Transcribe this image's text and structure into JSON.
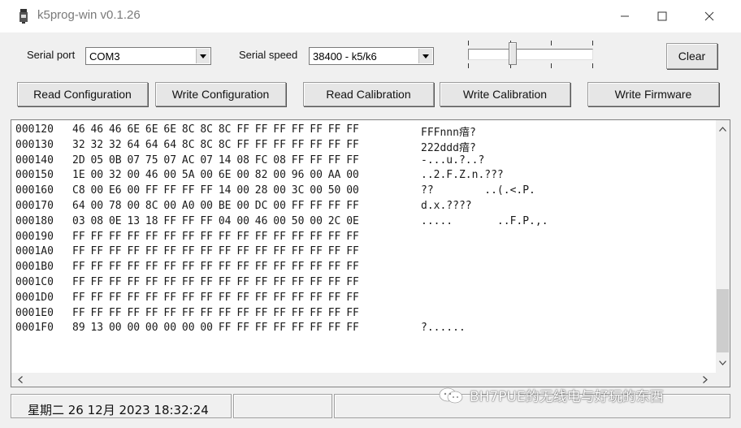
{
  "window": {
    "title": "k5prog-win v0.1.26"
  },
  "controls": {
    "serial_port_label": "Serial port",
    "serial_port_value": "COM3",
    "serial_speed_label": "Serial speed",
    "serial_speed_value": "38400 - k5/k6",
    "clear_button": "Clear",
    "slider_level": 0.35
  },
  "actions": {
    "read_config": "Read Configuration",
    "write_config": "Write Configuration",
    "read_calib": "Read Calibration",
    "write_calib": "Write Calibration",
    "write_firmware": "Write Firmware"
  },
  "hex_rows": [
    {
      "addr": "000120",
      "bytes": "46 46 46 6E 6E 6E 8C 8C 8C FF FF FF FF FF FF FF",
      "ascii": "FFFnnn瘖?"
    },
    {
      "addr": "000130",
      "bytes": "32 32 32 64 64 64 8C 8C 8C FF FF FF FF FF FF FF",
      "ascii": "222ddd瘖?"
    },
    {
      "addr": "000140",
      "bytes": "2D 05 0B 07 75 07 AC 07 14 08 FC 08 FF FF FF FF",
      "ascii": "-...u.?..?"
    },
    {
      "addr": "000150",
      "bytes": "1E 00 32 00 46 00 5A 00 6E 00 82 00 96 00 AA 00",
      "ascii": "..2.F.Z.n.???"
    },
    {
      "addr": "000160",
      "bytes": "C8 00 E6 00 FF FF FF FF 14 00 28 00 3C 00 50 00",
      "ascii": "??        ..(.<.P."
    },
    {
      "addr": "000170",
      "bytes": "64 00 78 00 8C 00 A0 00 BE 00 DC 00 FF FF FF FF",
      "ascii": "d.x.????"
    },
    {
      "addr": "000180",
      "bytes": "03 08 0E 13 18 FF FF FF 04 00 46 00 50 00 2C 0E",
      "ascii": ".....       ..F.P.,."
    },
    {
      "addr": "000190",
      "bytes": "FF FF FF FF FF FF FF FF FF FF FF FF FF FF FF FF",
      "ascii": ""
    },
    {
      "addr": "0001A0",
      "bytes": "FF FF FF FF FF FF FF FF FF FF FF FF FF FF FF FF",
      "ascii": ""
    },
    {
      "addr": "0001B0",
      "bytes": "FF FF FF FF FF FF FF FF FF FF FF FF FF FF FF FF",
      "ascii": ""
    },
    {
      "addr": "0001C0",
      "bytes": "FF FF FF FF FF FF FF FF FF FF FF FF FF FF FF FF",
      "ascii": ""
    },
    {
      "addr": "0001D0",
      "bytes": "FF FF FF FF FF FF FF FF FF FF FF FF FF FF FF FF",
      "ascii": ""
    },
    {
      "addr": "0001E0",
      "bytes": "FF FF FF FF FF FF FF FF FF FF FF FF FF FF FF FF",
      "ascii": ""
    },
    {
      "addr": "0001F0",
      "bytes": "89 13 00 00 00 00 00 00 FF FF FF FF FF FF FF FF",
      "ascii": "?......"
    }
  ],
  "status": {
    "datetime": "星期二 26 12月 2023  18:32:24"
  },
  "watermark": "BH7PUE的无线电与好玩的东西",
  "icons": {
    "app": "app-icon",
    "minimize": "minimize-icon",
    "maximize": "maximize-icon",
    "close": "close-icon"
  }
}
